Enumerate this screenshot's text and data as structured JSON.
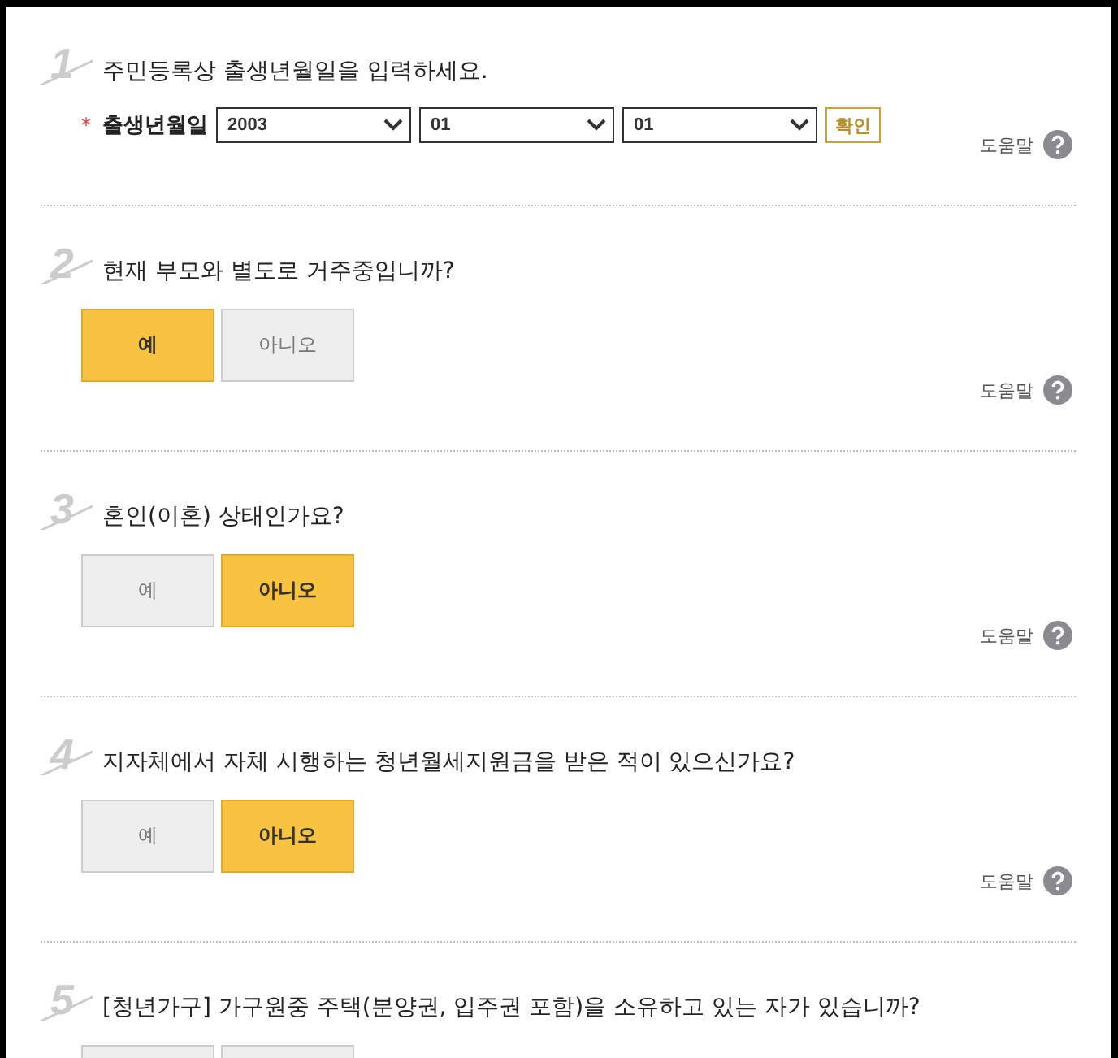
{
  "questions": [
    {
      "number": "1",
      "text": "주민등록상 출생년월일을 입력하세요.",
      "kind": "date",
      "field_label": "출생년월일",
      "required_mark": "*",
      "selects": [
        {
          "value": "2003"
        },
        {
          "value": "01"
        },
        {
          "value": "01"
        }
      ],
      "confirm": "확인",
      "help": "도움말"
    },
    {
      "number": "2",
      "text": "현재 부모와 별도로 거주중입니까?",
      "kind": "choice",
      "options": [
        {
          "label": "예",
          "selected": true
        },
        {
          "label": "아니오",
          "selected": false
        }
      ],
      "help": "도움말"
    },
    {
      "number": "3",
      "text": "혼인(이혼) 상태인가요?",
      "kind": "choice",
      "options": [
        {
          "label": "예",
          "selected": false
        },
        {
          "label": "아니오",
          "selected": true
        }
      ],
      "help": "도움말"
    },
    {
      "number": "4",
      "text": "지자체에서 자체 시행하는 청년월세지원금을 받은 적이 있으신가요?",
      "kind": "choice",
      "options": [
        {
          "label": "예",
          "selected": false
        },
        {
          "label": "아니오",
          "selected": true
        }
      ],
      "help": "도움말"
    },
    {
      "number": "5",
      "text": "[청년가구] 가구원중 주택(분양권, 입주권 포함)을 소유하고 있는 자가 있습니까?",
      "kind": "choice",
      "options": [
        {
          "selected": false
        },
        {
          "selected": false
        }
      ]
    }
  ]
}
